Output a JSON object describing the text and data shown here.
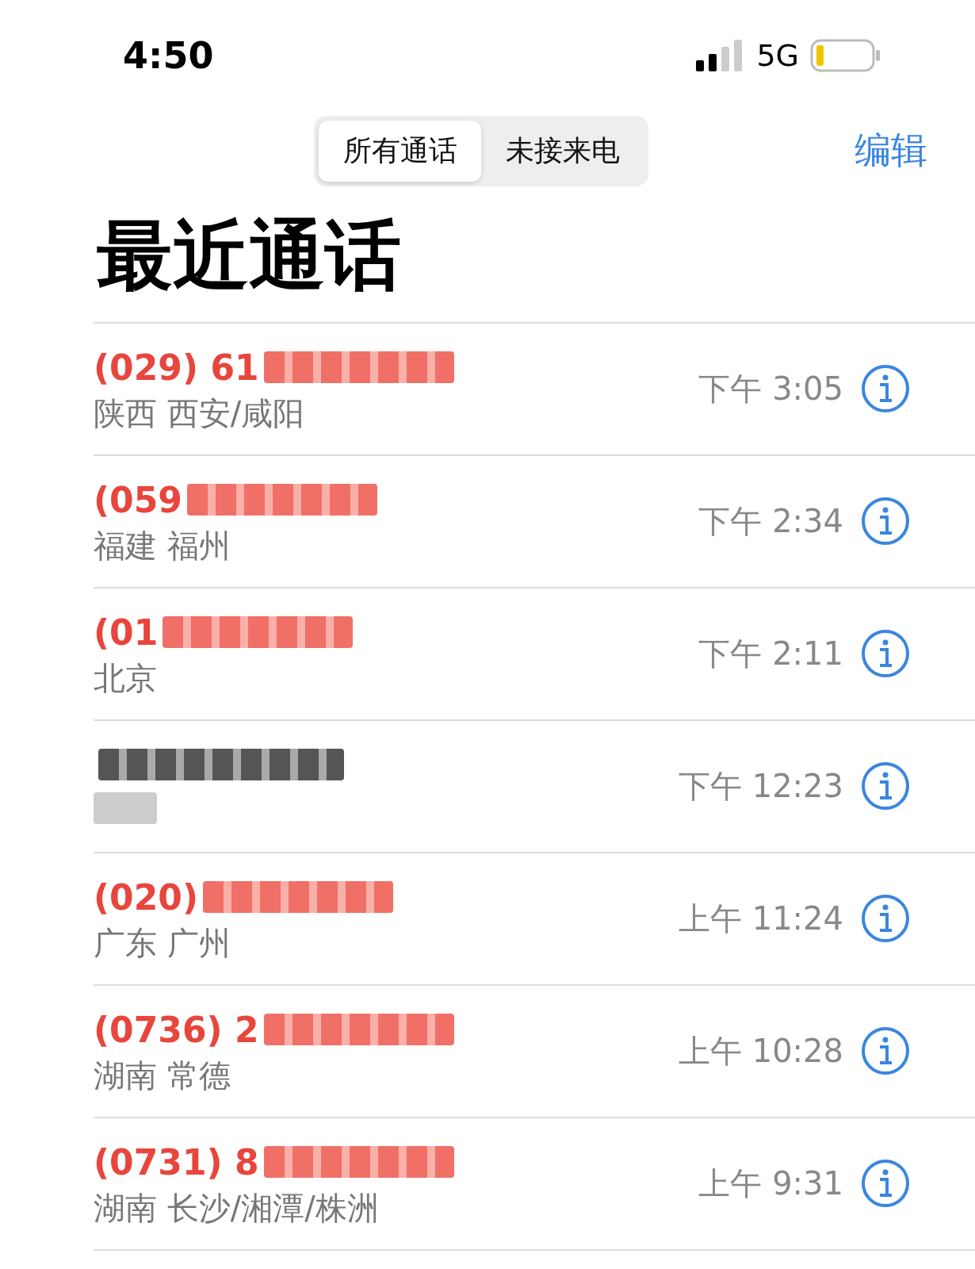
{
  "status_bar": {
    "time": "4:50",
    "network": "5G"
  },
  "segments": [
    {
      "label": "所有通话",
      "selected": true
    },
    {
      "label": "未接来电",
      "selected": false
    }
  ],
  "edit_button": "编辑",
  "title": "最近通话",
  "calls": [
    {
      "number": "(029) 61",
      "location": "陕西 西安/咸阳",
      "time": "下午 3:05",
      "missed": true,
      "redacted": true
    },
    {
      "number": "(059",
      "location": "福建 福州",
      "time": "下午 2:34",
      "missed": true,
      "redacted": true
    },
    {
      "number": "(01",
      "location": "北京",
      "time": "下午 2:11",
      "missed": true,
      "redacted": true
    },
    {
      "time": "下午 12:23",
      "missed": false,
      "redacted": true
    },
    {
      "number": "(020)",
      "location": "广东 广州",
      "time": "上午 11:24",
      "missed": true,
      "redacted": true
    },
    {
      "number": "(0736) 2",
      "location": "湖南 常德",
      "time": "上午 10:28",
      "missed": true,
      "redacted": true
    },
    {
      "number": "(0731) 8",
      "location": "湖南 长沙/湘潭/株洲",
      "time": "上午 9:31",
      "missed": true,
      "redacted": true
    }
  ]
}
